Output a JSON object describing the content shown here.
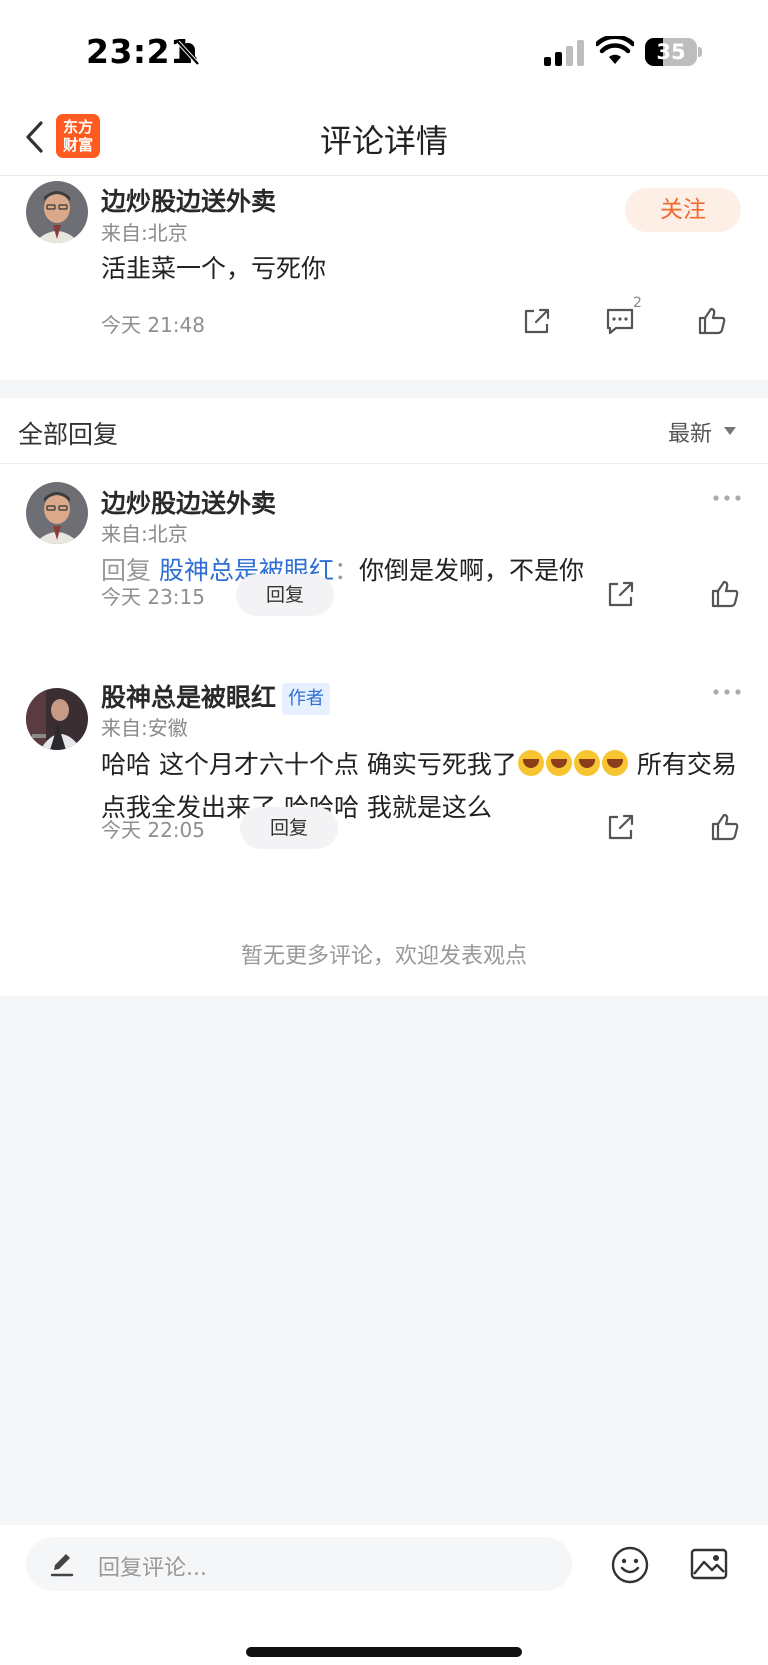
{
  "status_bar": {
    "time": "23:21",
    "battery": "35",
    "battery_level": 0.35
  },
  "nav": {
    "title": "评论详情",
    "logo_line1": "东方",
    "logo_line2": "财富",
    "back_icon": "chevron-left-icon"
  },
  "main_comment": {
    "username": "边炒股边送外卖",
    "location": "来自:北京",
    "text": "活韭菜一个，亏死你",
    "time": "今天 21:48",
    "follow_label": "关注",
    "comment_count": "2"
  },
  "replies": {
    "header": "全部回复",
    "sort_label": "最新",
    "items": [
      {
        "username": "边炒股边送外卖",
        "location": "来自:北京",
        "prefix": "回复",
        "mention": "股神总是被眼红",
        "separator": "：",
        "text": "你倒是发啊，不是你",
        "time": "今天 23:15",
        "reply_label": "回复"
      },
      {
        "username": "股神总是被眼红",
        "badge": "作者",
        "location": "来自:安徽",
        "text_part1": "哈哈 这个月才六十个点 确实亏死我了",
        "text_part2": " 所有交易点我全发出来了 哈哈哈 我就是这么",
        "emoji_name": "loudly-crying-face",
        "time": "今天 22:05",
        "reply_label": "回复"
      }
    ],
    "no_more": "暂无更多评论，欢迎发表观点"
  },
  "bottom": {
    "input_placeholder": "回复评论..."
  },
  "colors": {
    "accent": "#f2692d",
    "link": "#2f6fd4",
    "logo": "#ff5a1f"
  }
}
